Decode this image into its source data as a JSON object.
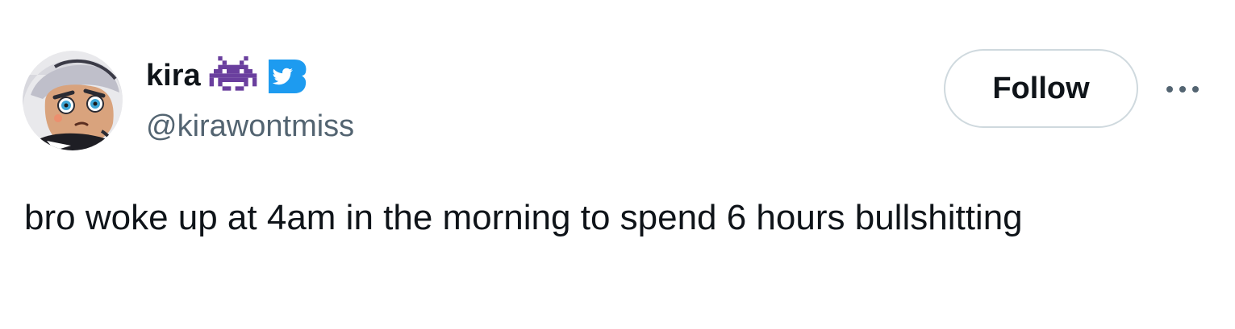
{
  "user": {
    "display_name": "kira",
    "handle": "@kirawontmiss",
    "avatar_icon": "cartoon-avatar",
    "badges": [
      "space-invader-emoji",
      "twitter-bird-verified-icon"
    ]
  },
  "actions": {
    "follow_label": "Follow",
    "more_icon": "more-dots-icon"
  },
  "tweet": {
    "text": "bro woke up at 4am in the morning to spend 6 hours bullshitting"
  },
  "colors": {
    "text_primary": "#0f1419",
    "text_secondary": "#536471",
    "border": "#cfd9de",
    "twitter_blue": "#1d9bf0",
    "invader_purple": "#6a3f9e"
  }
}
